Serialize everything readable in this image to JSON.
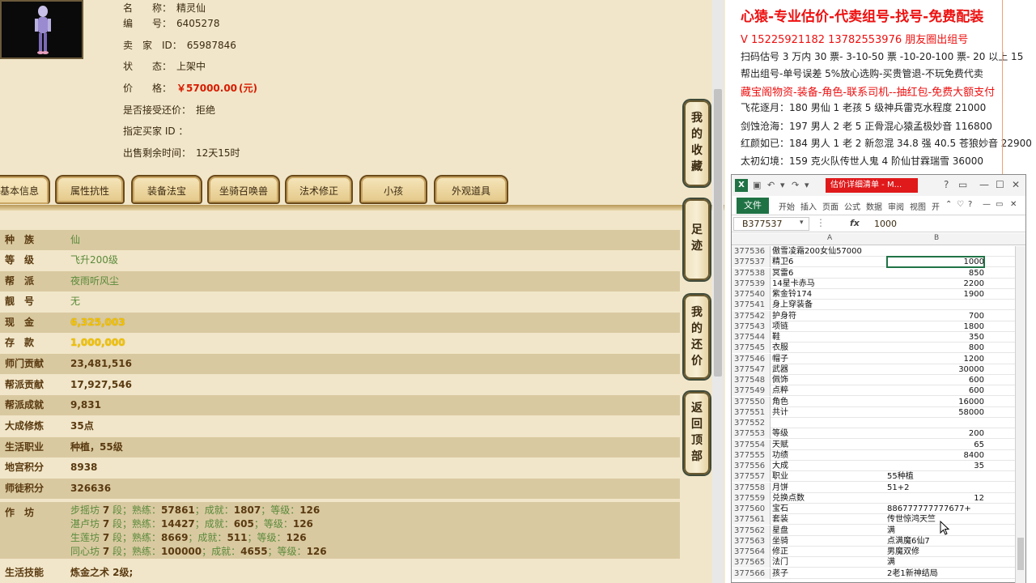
{
  "game": {
    "info": [
      {
        "label": "名　　称：",
        "value": "精灵仙"
      },
      {
        "label": "编　　号：",
        "value": "6405278"
      },
      {
        "label": "卖　家　ID：",
        "value": "65987846"
      },
      {
        "label": "状　　态：",
        "value": "上架中"
      },
      {
        "label": "价　　格：",
        "value": "￥57000.00",
        "unit": "(元)"
      },
      {
        "label": "是否接受还价：",
        "value": "拒绝"
      },
      {
        "label": "指定买家 ID ：",
        "value": ""
      },
      {
        "label": "出售剩余时间：",
        "value": "12天15时"
      }
    ],
    "tabs": [
      "基本信息",
      "属性抗性",
      "装备法宝",
      "坐骑召唤兽",
      "法术修正",
      "小孩",
      "外观道具"
    ],
    "attributes": [
      {
        "key": "种　族",
        "value": "仙"
      },
      {
        "key": "等　级",
        "value": "飞升200级"
      },
      {
        "key": "帮　派",
        "value": "夜雨听风尘"
      },
      {
        "key": "靓　号",
        "value": "无"
      },
      {
        "key": "现　金",
        "value": "6,325,003"
      },
      {
        "key": "存　款",
        "value": "1,000,000"
      },
      {
        "key": "师门贡献",
        "value": "23,481,516"
      },
      {
        "key": "帮派贡献",
        "value": "17,927,546"
      },
      {
        "key": "帮派成就",
        "value": "9,831"
      },
      {
        "key": "大成修炼",
        "value": "35点"
      },
      {
        "key": "生活职业",
        "value": "种植，55级"
      },
      {
        "key": "地宫积分",
        "value": "8938"
      },
      {
        "key": "师徒积分",
        "value": "326636"
      }
    ],
    "workshop": {
      "key": "作　坊",
      "lines": [
        {
          "name": "步摇坊",
          "level": "7",
          "proficiency": "57861",
          "achievement": "1807",
          "grade": "126"
        },
        {
          "name": "湛卢坊",
          "level": "7",
          "proficiency": "14427",
          "achievement": "605",
          "grade": "126"
        },
        {
          "name": "生莲坊",
          "level": "7",
          "proficiency": "8669",
          "achievement": "511",
          "grade": "126"
        },
        {
          "name": "同心坊",
          "level": "7",
          "proficiency": "100000",
          "achievement": "4655",
          "grade": "126"
        }
      ],
      "labels": {
        "segment": "段；熟练：",
        "achievement": "；成就：",
        "grade": "；等级："
      }
    },
    "skill": {
      "key": "生活技能",
      "value": "炼金之术 2级;"
    },
    "side_buttons": [
      {
        "label": [
          "我",
          "的",
          "收",
          "藏"
        ]
      },
      {
        "label": [
          "足",
          "迹"
        ]
      },
      {
        "label": [
          "我",
          "的",
          "还",
          "价"
        ]
      },
      {
        "label": [
          "返",
          "回",
          "顶",
          "部"
        ]
      }
    ]
  },
  "ad": {
    "headline": "心猿-专业估价-代卖组号-找号-免费配装",
    "contact": "V 15225921182   13782553976 朋友圈出组号",
    "lines": [
      {
        "text": "扫码估号 3 万内 30 票- 3-10-50 票  -10-20-100 票- 20 以上 15",
        "red": false
      },
      {
        "text": "帮出组号-单号误差 5%放心选购-买贵管退-不玩免费代卖",
        "red": false
      },
      {
        "text": "藏宝阁物资-装备-角色-联系司机--抽红包-免费大额支付",
        "red": true
      },
      {
        "text": "飞花逐月：180 男仙 1 老孩 5 级神兵雷克水程度 21000",
        "red": false
      },
      {
        "text": "剑蚀沧海：197 男人 2 老 5 正骨混心猿孟极妙音 116800",
        "red": false
      },
      {
        "text": "红颜如已：184 男人 1 老 2 新忽混 34.8 强 40.5 苍狼妙音 22900",
        "red": false
      },
      {
        "text": "太初幻境：159 克火队传世人鬼 4 阶仙甘霖瑞雪 36000",
        "red": false
      }
    ]
  },
  "excel": {
    "doc_title": "估价详细清单 - M...",
    "file_tab": "文件",
    "ribbon_tabs": [
      "开始",
      "插入",
      "页面",
      "公式",
      "数据",
      "审阅",
      "视图",
      "开"
    ],
    "namebox": "B377537",
    "fx": "fx",
    "formula_value": "1000",
    "col_a": "A",
    "col_b": "B",
    "rows": [
      {
        "n": "377536",
        "a": "傲雪凌霜200女仙57000",
        "b": "",
        "num": false
      },
      {
        "n": "377537",
        "a": "精卫6",
        "b": "1000",
        "num": true
      },
      {
        "n": "377538",
        "a": "冥雷6",
        "b": "850",
        "num": true
      },
      {
        "n": "377539",
        "a": "14星卡赤马",
        "b": "2200",
        "num": true
      },
      {
        "n": "377540",
        "a": "紫金铃174",
        "b": "1900",
        "num": true
      },
      {
        "n": "377541",
        "a": "身上穿装备",
        "b": "",
        "num": false
      },
      {
        "n": "377542",
        "a": "护身符",
        "b": "700",
        "num": true
      },
      {
        "n": "377543",
        "a": "项链",
        "b": "1800",
        "num": true
      },
      {
        "n": "377544",
        "a": "鞋",
        "b": "350",
        "num": true
      },
      {
        "n": "377545",
        "a": "衣服",
        "b": "800",
        "num": true
      },
      {
        "n": "377546",
        "a": "帽子",
        "b": "1200",
        "num": true
      },
      {
        "n": "377547",
        "a": "武器",
        "b": "30000",
        "num": true
      },
      {
        "n": "377548",
        "a": "佩饰",
        "b": "600",
        "num": true
      },
      {
        "n": "377549",
        "a": "点粹",
        "b": "600",
        "num": true
      },
      {
        "n": "377550",
        "a": "角色",
        "b": "16000",
        "num": true
      },
      {
        "n": "377551",
        "a": "共计",
        "b": "58000",
        "num": true
      },
      {
        "n": "377552",
        "a": "",
        "b": "",
        "num": false
      },
      {
        "n": "377553",
        "a": "等级",
        "b": "200",
        "num": true
      },
      {
        "n": "377554",
        "a": "天赋",
        "b": "65",
        "num": true
      },
      {
        "n": "377555",
        "a": "功绩",
        "b": "8400",
        "num": true
      },
      {
        "n": "377556",
        "a": "大成",
        "b": "35",
        "num": true
      },
      {
        "n": "377557",
        "a": "职业",
        "b": "55种植",
        "num": false
      },
      {
        "n": "377558",
        "a": "月饼",
        "b": "51+2",
        "num": false
      },
      {
        "n": "377559",
        "a": "兑换点数",
        "b": "12",
        "num": true
      },
      {
        "n": "377560",
        "a": "宝石",
        "b": "886777777777677+",
        "num": false
      },
      {
        "n": "377561",
        "a": "套装",
        "b": "传世惊鸿天竺",
        "num": false
      },
      {
        "n": "377562",
        "a": "星盘",
        "b": "满",
        "num": false
      },
      {
        "n": "377563",
        "a": "坐骑",
        "b": "点满魔6仙7",
        "num": false
      },
      {
        "n": "377564",
        "a": "修正",
        "b": "男魔双修",
        "num": false
      },
      {
        "n": "377565",
        "a": "法门",
        "b": "满",
        "num": false
      },
      {
        "n": "377566",
        "a": "孩子",
        "b": "2老1新神结局",
        "num": false
      }
    ]
  }
}
